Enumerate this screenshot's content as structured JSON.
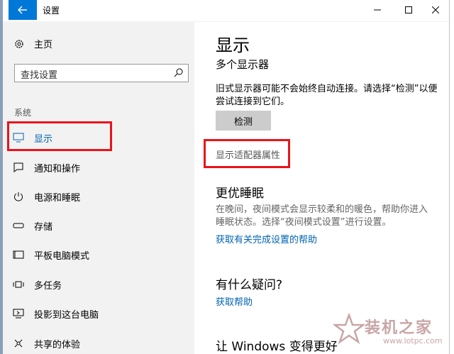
{
  "window": {
    "title": "设置",
    "controls": {
      "minimize": "—",
      "maximize": "☐",
      "close": "✕"
    }
  },
  "sidebar": {
    "home_label": "主页",
    "search_placeholder": "查找设置",
    "section_label": "系统",
    "items": [
      {
        "label": "显示",
        "icon": "monitor-icon",
        "active": true
      },
      {
        "label": "通知和操作",
        "icon": "notification-icon"
      },
      {
        "label": "电源和睡眠",
        "icon": "power-icon"
      },
      {
        "label": "存储",
        "icon": "storage-icon"
      },
      {
        "label": "平板电脑模式",
        "icon": "tablet-icon"
      },
      {
        "label": "多任务",
        "icon": "multitask-icon"
      },
      {
        "label": "投影到这台电脑",
        "icon": "project-icon"
      },
      {
        "label": "共享的体验",
        "icon": "share-icon"
      }
    ]
  },
  "main": {
    "title": "显示",
    "multi_display_heading": "多个显示器",
    "multi_display_desc_1": "旧式显示器可能不会始终自动连接。请选择“检测”以便",
    "multi_display_desc_2": "尝试连接到它们。",
    "detect_button": "检测",
    "adapter_link": "显示适配器属性",
    "sleep_heading": "更优睡眠",
    "sleep_desc_1": "在晚间，夜间模式会显示较柔和的暖色，帮助你进入",
    "sleep_desc_2": "睡眠状态。选择“夜间模式设置”进行设置。",
    "sleep_link": "获取有关完成设置的帮助",
    "question_heading": "有什么疑问?",
    "help_link": "获取帮助",
    "improve_heading": "让 Windows 变得更好"
  },
  "watermark": {
    "text": "装机之家",
    "url": "www.lotpc.com"
  },
  "colors": {
    "accent": "#0078d7",
    "highlight_box": "#e8141b",
    "link": "#0063b1",
    "sidebar_bg": "#f2f2f2"
  }
}
